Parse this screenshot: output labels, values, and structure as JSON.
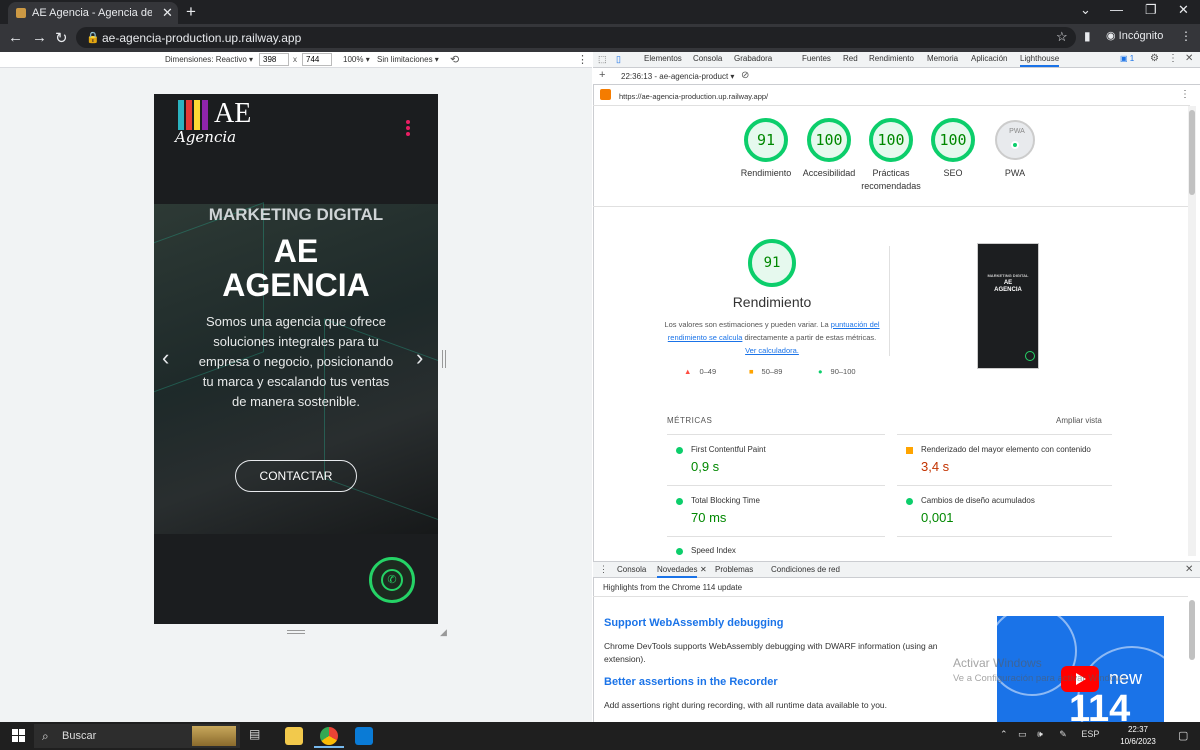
{
  "browser": {
    "tab_title": "AE Agencia - Agencia de Marketi",
    "url": "ae-agencia-production.up.railway.app",
    "profile_label": "Incógnito"
  },
  "device_toolbar": {
    "dimensions_label": "Dimensiones: Reactivo",
    "width": "398",
    "times": "x",
    "height": "744",
    "zoom": "100%",
    "throttle": "Sin limitaciones"
  },
  "page": {
    "logo_letters": "AE",
    "logo_script": "Agencia",
    "kicker": "MARKETING DIGITAL",
    "title_line1": "AE",
    "title_line2": "AGENCIA",
    "description": "Somos una agencia que ofrece soluciones integrales para tu empresa o negocio, posicionando tu marca y escalando tus ventas de manera sostenible.",
    "cta": "CONTACTAR"
  },
  "devtools": {
    "tabs": [
      "Elementos",
      "Consola",
      "Grabadora",
      "Fuentes",
      "Red",
      "Rendimiento",
      "Memoria",
      "Aplicación",
      "Lighthouse"
    ],
    "badge": "1",
    "report_select": "22:36:13 - ae-agencia-product",
    "report_url": "https://ae-agencia-production.up.railway.app/",
    "scores": [
      {
        "value": "91",
        "label": "Rendimiento"
      },
      {
        "value": "100",
        "label": "Accesibilidad"
      },
      {
        "value": "100",
        "label": "Prácticas recomendadas"
      },
      {
        "value": "100",
        "label": "SEO"
      }
    ],
    "pwa_label": "PWA",
    "pwa_badge": "PWA",
    "perf": {
      "score": "91",
      "title": "Rendimiento",
      "note_prefix": "Los valores son estimaciones y pueden variar. La ",
      "note_link": "puntuación del rendimiento se calcula",
      "note_mid": " directamente a partir de estas métricas. ",
      "note_link2": "Ver calculadora.",
      "legend": [
        {
          "symbol": "▲",
          "range": "0–49",
          "color": "#ff4e42"
        },
        {
          "symbol": "■",
          "range": "50–89",
          "color": "#ffa400"
        },
        {
          "symbol": "●",
          "range": "90–100",
          "color": "#0cce6b"
        }
      ]
    },
    "thumb_text": [
      "MARKETING DIGITAL",
      "AE",
      "AGENCIA"
    ],
    "metrics_title": "MÉTRICAS",
    "metrics_expand": "Ampliar vista",
    "metrics": [
      {
        "name": "First Contentful Paint",
        "value": "0,9 s",
        "status": "pass"
      },
      {
        "name": "Renderizado del mayor elemento con contenido",
        "value": "3,4 s",
        "status": "average"
      },
      {
        "name": "Total Blocking Time",
        "value": "70 ms",
        "status": "pass"
      },
      {
        "name": "Cambios de diseño acumulados",
        "value": "0,001",
        "status": "pass"
      },
      {
        "name": "Speed Index",
        "value": "",
        "status": "pass"
      }
    ],
    "colors": {
      "pass": "#0cce6b",
      "pass_text": "#008800",
      "average": "#ffa400",
      "average_text": "#c33300",
      "accent": "#1a73e8"
    }
  },
  "drawer": {
    "tabs": [
      "Consola",
      "Novedades",
      "Problemas",
      "Condiciones de red"
    ],
    "highlights": "Highlights from the Chrome 114 update",
    "items": [
      {
        "title": "Support WebAssembly debugging",
        "text": "Chrome DevTools supports WebAssembly debugging with DWARF information (using an extension)."
      },
      {
        "title": "Better assertions in the Recorder",
        "text": "Add assertions right during recording, with all runtime data available to you."
      }
    ],
    "video_new": "new",
    "video_num": "114"
  },
  "watermark": {
    "title": "Activar Windows",
    "subtitle": "Ve a Configuración para activar Windows."
  },
  "taskbar": {
    "search": "Buscar",
    "lang": "ESP",
    "time": "22:37",
    "date": "10/6/2023"
  }
}
